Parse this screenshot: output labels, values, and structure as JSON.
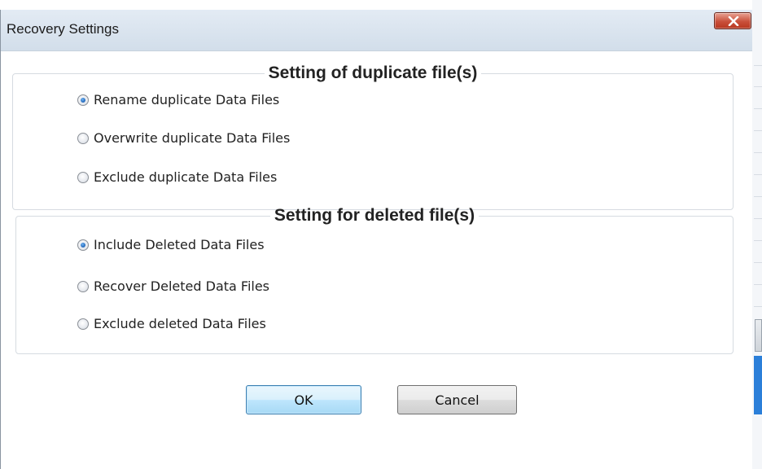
{
  "dialog": {
    "title": "Recovery Settings",
    "close_icon": "close-x-icon"
  },
  "duplicate_group": {
    "legend": "Setting of duplicate file(s)",
    "options": [
      {
        "label": "Rename duplicate  Data Files",
        "checked": true
      },
      {
        "label": "Overwrite duplicate Data Files",
        "checked": false
      },
      {
        "label": "Exclude  duplicate Data Files",
        "checked": false
      }
    ]
  },
  "deleted_group": {
    "legend": "Setting for deleted file(s)",
    "options": [
      {
        "label": "Include Deleted Data Files",
        "checked": true
      },
      {
        "label": "Recover  Deleted  Data Files",
        "checked": false
      },
      {
        "label": "Exclude deleted Data Files",
        "checked": false
      }
    ]
  },
  "buttons": {
    "ok": "OK",
    "cancel": "Cancel"
  },
  "colors": {
    "close_button": "#c9503b",
    "radio_selected": "#1c5fb3",
    "ok_border": "#3c7fb1"
  }
}
